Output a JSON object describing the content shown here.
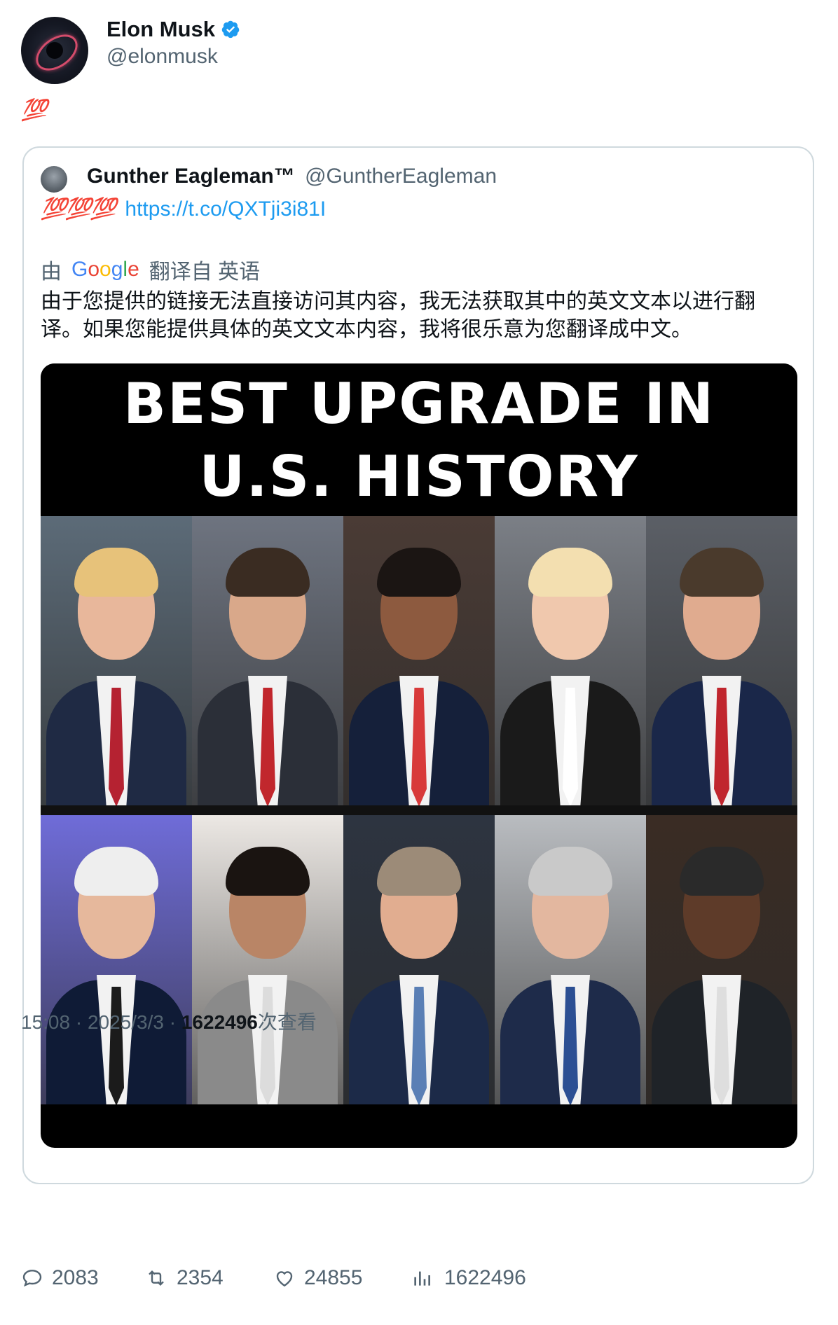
{
  "author": {
    "name": "Elon Musk",
    "handle": "@elonmusk",
    "verified_icon": "verified-badge-icon",
    "avatar_icon": "black-hole-avatar"
  },
  "post_text": "💯",
  "quote": {
    "author_name": "Gunther Eagleman™",
    "author_handle": "@GuntherEagleman",
    "emoji_text": "💯💯💯",
    "link": "https://t.co/QXTji3i81I",
    "translation": {
      "by_label": "由",
      "provider": "Google",
      "from_label": "翻译自 英语",
      "text": "由于您提供的链接无法直接访问其内容，我无法获取其中的英文文本以进行翻译。如果您能提供具体的英文文本内容，我将很乐意为您翻译成中文。"
    },
    "media": {
      "headline_line1": "BEST UPGRADE IN",
      "headline_line2": "U.S. HISTORY",
      "photo_count": 10
    }
  },
  "meta": {
    "time": "15:08",
    "separator1": " · ",
    "date": "2025/3/3",
    "separator2": " · ",
    "views_count": "1622496",
    "views_label": "次查看"
  },
  "actions": {
    "replies": "2083",
    "retweets": "2354",
    "likes": "24855",
    "views": "1622496"
  },
  "colors": {
    "link_blue": "#1d9bf0",
    "secondary_text": "#536471",
    "border": "#cfd9de",
    "emoji_red": "#e0245e"
  }
}
